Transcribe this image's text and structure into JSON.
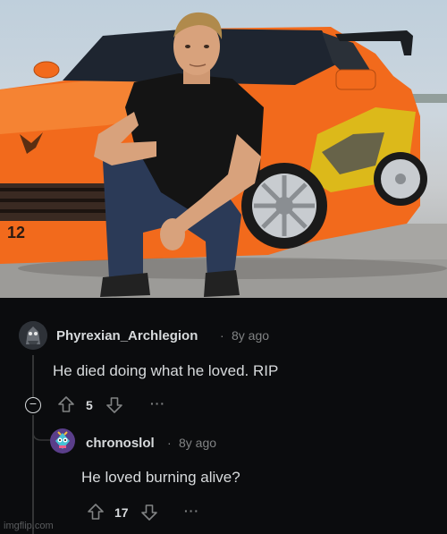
{
  "comments": [
    {
      "author": "Phyrexian_Archlegion",
      "age": "8y ago",
      "text": "He died doing what he loved. RIP",
      "score": "5",
      "collapse_symbol": "−",
      "more": "···"
    },
    {
      "author": "chronoslol",
      "age": "8y ago",
      "text": "He loved burning alive?",
      "score": "17",
      "more": "···"
    }
  ],
  "separator": "·",
  "watermark": "imgflip.com",
  "photo": {
    "license_plate": "12"
  },
  "colors": {
    "background": "#0b0c0e",
    "text": "#d7dadc",
    "muted": "#818384",
    "car_orange": "#f26a1c"
  },
  "icons": [
    "upvote-icon",
    "downvote-icon",
    "more-icon",
    "collapse-icon",
    "avatar"
  ]
}
